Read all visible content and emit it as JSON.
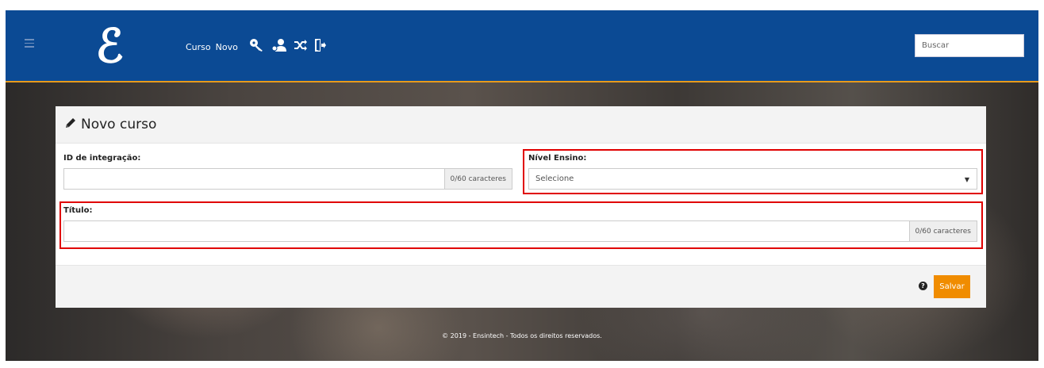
{
  "header": {
    "logo": "ℰ",
    "nav_links": [
      "Curso",
      "Novo"
    ],
    "icons": [
      "key-icon",
      "user-key-icon",
      "shuffle-icon",
      "sign-out-icon"
    ],
    "search_placeholder": "Buscar"
  },
  "form": {
    "title": "Novo curso",
    "fields": {
      "integration_id": {
        "label": "ID de integração:",
        "value": "",
        "counter": "0/60 caracteres"
      },
      "level": {
        "label": "Nível Ensino:",
        "selected": "Selecione"
      },
      "title": {
        "label": "Título:",
        "value": "",
        "counter": "0/60 caracteres"
      }
    },
    "save_label": "Salvar",
    "help_icon": "?"
  },
  "footer": {
    "text": "© 2019 - Ensintech - Todos os direitos reservados."
  },
  "colors": {
    "navbar": "#0b4a94",
    "accent": "#e79a1c",
    "save_button": "#f08c00",
    "highlight": "#e00000"
  }
}
